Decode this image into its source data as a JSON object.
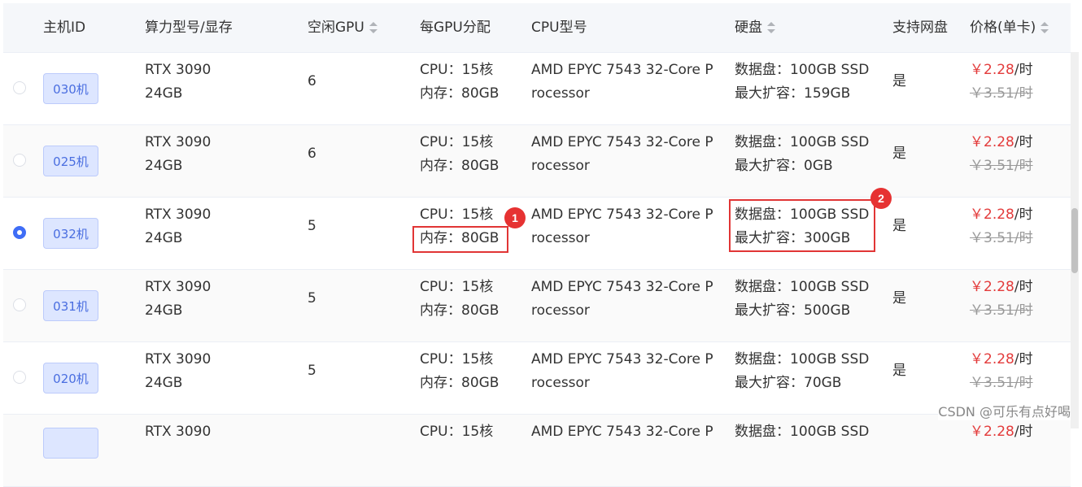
{
  "columns": {
    "host_id": "主机ID",
    "model": "算力型号/显存",
    "free_gpu": "空闲GPU",
    "per_gpu": "每GPU分配",
    "cpu_model": "CPU型号",
    "disk": "硬盘",
    "net_disk": "支持网盘",
    "price": "价格(单卡)"
  },
  "rows": [
    {
      "selected": false,
      "host_id": "030机",
      "model_name": "RTX 3090",
      "vram": "24GB",
      "free_gpu": "6",
      "cpu_alloc": "CPU：15核",
      "mem_alloc": "内存：80GB",
      "cpu_model_line1": "AMD EPYC 7543 32-Core P",
      "cpu_model_line2": "rocessor",
      "disk_data": "数据盘：100GB SSD",
      "disk_max": "最大扩容：159GB",
      "net_disk": "是",
      "price_now": "￥2.28",
      "price_unit": "/时",
      "price_old": "￥3.51/时"
    },
    {
      "selected": false,
      "host_id": "025机",
      "model_name": "RTX 3090",
      "vram": "24GB",
      "free_gpu": "6",
      "cpu_alloc": "CPU：15核",
      "mem_alloc": "内存：80GB",
      "cpu_model_line1": "AMD EPYC 7543 32-Core P",
      "cpu_model_line2": "rocessor",
      "disk_data": "数据盘：100GB SSD",
      "disk_max": "最大扩容：0GB",
      "net_disk": "是",
      "price_now": "￥2.28",
      "price_unit": "/时",
      "price_old": "￥3.51/时"
    },
    {
      "selected": true,
      "host_id": "032机",
      "model_name": "RTX 3090",
      "vram": "24GB",
      "free_gpu": "5",
      "cpu_alloc": "CPU：15核",
      "mem_alloc": "内存：80GB",
      "cpu_model_line1": "AMD EPYC 7543 32-Core P",
      "cpu_model_line2": "rocessor",
      "disk_data": "数据盘：100GB SSD",
      "disk_max": "最大扩容：300GB",
      "net_disk": "是",
      "price_now": "￥2.28",
      "price_unit": "/时",
      "price_old": "￥3.51/时"
    },
    {
      "selected": false,
      "host_id": "031机",
      "model_name": "RTX 3090",
      "vram": "24GB",
      "free_gpu": "5",
      "cpu_alloc": "CPU：15核",
      "mem_alloc": "内存：80GB",
      "cpu_model_line1": "AMD EPYC 7543 32-Core P",
      "cpu_model_line2": "rocessor",
      "disk_data": "数据盘：100GB SSD",
      "disk_max": "最大扩容：500GB",
      "net_disk": "是",
      "price_now": "￥2.28",
      "price_unit": "/时",
      "price_old": "￥3.51/时"
    },
    {
      "selected": false,
      "host_id": "020机",
      "model_name": "RTX 3090",
      "vram": "24GB",
      "free_gpu": "5",
      "cpu_alloc": "CPU：15核",
      "mem_alloc": "内存：80GB",
      "cpu_model_line1": "AMD EPYC 7543 32-Core P",
      "cpu_model_line2": "rocessor",
      "disk_data": "数据盘：100GB SSD",
      "disk_max": "最大扩容：70GB",
      "net_disk": "是",
      "price_now": "￥2.28",
      "price_unit": "/时",
      "price_old": "￥3.51/时"
    },
    {
      "selected": false,
      "host_id": "",
      "model_name": "RTX 3090",
      "vram": "",
      "free_gpu": "",
      "cpu_alloc": "CPU：15核",
      "mem_alloc": "",
      "cpu_model_line1": "AMD EPYC 7543 32-Core P",
      "cpu_model_line2": "",
      "disk_data": "数据盘：100GB SSD",
      "disk_max": "",
      "net_disk": "",
      "price_now": "￥2.28",
      "price_unit": "/时",
      "price_old": ""
    }
  ],
  "annotations": {
    "badge_1": "1",
    "badge_2": "2"
  },
  "watermark": "CSDN @可乐有点好喝",
  "colors": {
    "accent": "#3f6df6",
    "price": "#e33b3b",
    "highlight": "#e13535"
  }
}
